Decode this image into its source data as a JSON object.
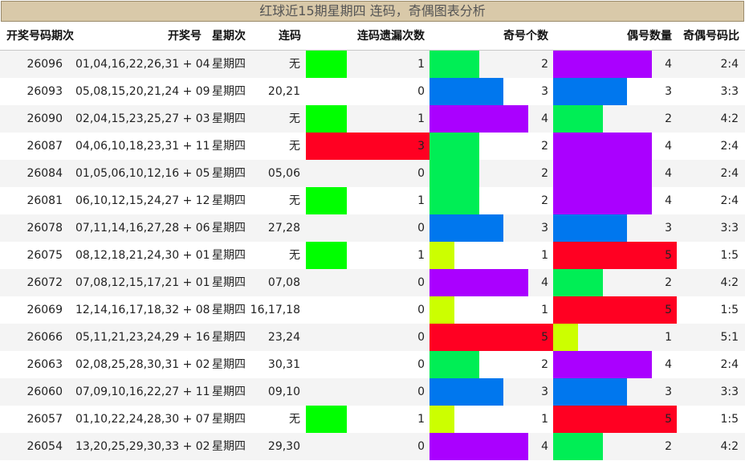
{
  "title": "红球近15期星期四 连码，奇偶图表分析",
  "headers": {
    "qi": "开奖号码期次",
    "numbers": "开奖号",
    "weekday": "星期次",
    "lianma": "连码",
    "miss": "连码遗漏次数",
    "odd": "奇号个数",
    "even": "偶号数量",
    "ratio": "奇偶号码比"
  },
  "colors": {
    "level_1": "#ccff00",
    "level_2": "#00ee55",
    "level_3": "#0077ee",
    "level_4": "#aa00ff",
    "level_5": "#ff0022",
    "miss_1": "#00ff00",
    "miss_3": "#ff0022",
    "row_alt": "#f4f4f4",
    "title_bg": "#d9c9a9"
  },
  "rows": [
    {
      "qi": "26096",
      "numbers": "01,04,16,22,26,31 + 04",
      "weekday": "星期四",
      "lianma": "无",
      "miss": 1,
      "odd": 2,
      "even": 4,
      "ratio": "2:4"
    },
    {
      "qi": "26093",
      "numbers": "05,08,15,20,21,24 + 09",
      "weekday": "星期四",
      "lianma": "20,21",
      "miss": 0,
      "odd": 3,
      "even": 3,
      "ratio": "3:3"
    },
    {
      "qi": "26090",
      "numbers": "02,04,15,23,25,27 + 03",
      "weekday": "星期四",
      "lianma": "无",
      "miss": 1,
      "odd": 4,
      "even": 2,
      "ratio": "4:2"
    },
    {
      "qi": "26087",
      "numbers": "04,06,10,18,23,31 + 11",
      "weekday": "星期四",
      "lianma": "无",
      "miss": 3,
      "odd": 2,
      "even": 4,
      "ratio": "2:4"
    },
    {
      "qi": "26084",
      "numbers": "01,05,06,10,12,16 + 05",
      "weekday": "星期四",
      "lianma": "05,06",
      "miss": 0,
      "odd": 2,
      "even": 4,
      "ratio": "2:4"
    },
    {
      "qi": "26081",
      "numbers": "06,10,12,15,24,27 + 12",
      "weekday": "星期四",
      "lianma": "无",
      "miss": 1,
      "odd": 2,
      "even": 4,
      "ratio": "2:4"
    },
    {
      "qi": "26078",
      "numbers": "07,11,14,16,27,28 + 06",
      "weekday": "星期四",
      "lianma": "27,28",
      "miss": 0,
      "odd": 3,
      "even": 3,
      "ratio": "3:3"
    },
    {
      "qi": "26075",
      "numbers": "08,12,18,21,24,30 + 01",
      "weekday": "星期四",
      "lianma": "无",
      "miss": 1,
      "odd": 1,
      "even": 5,
      "ratio": "1:5"
    },
    {
      "qi": "26072",
      "numbers": "07,08,12,15,17,21 + 01",
      "weekday": "星期四",
      "lianma": "07,08",
      "miss": 0,
      "odd": 4,
      "even": 2,
      "ratio": "4:2"
    },
    {
      "qi": "26069",
      "numbers": "12,14,16,17,18,32 + 08",
      "weekday": "星期四",
      "lianma": "16,17,18",
      "miss": 0,
      "odd": 1,
      "even": 5,
      "ratio": "1:5"
    },
    {
      "qi": "26066",
      "numbers": "05,11,21,23,24,29 + 16",
      "weekday": "星期四",
      "lianma": "23,24",
      "miss": 0,
      "odd": 5,
      "even": 1,
      "ratio": "5:1"
    },
    {
      "qi": "26063",
      "numbers": "02,08,25,28,30,31 + 02",
      "weekday": "星期四",
      "lianma": "30,31",
      "miss": 0,
      "odd": 2,
      "even": 4,
      "ratio": "2:4"
    },
    {
      "qi": "26060",
      "numbers": "07,09,10,16,22,27 + 11",
      "weekday": "星期四",
      "lianma": "09,10",
      "miss": 0,
      "odd": 3,
      "even": 3,
      "ratio": "3:3"
    },
    {
      "qi": "26057",
      "numbers": "01,10,22,24,28,30 + 07",
      "weekday": "星期四",
      "lianma": "无",
      "miss": 1,
      "odd": 1,
      "even": 5,
      "ratio": "1:5"
    },
    {
      "qi": "26054",
      "numbers": "13,20,25,29,30,33 + 02",
      "weekday": "星期四",
      "lianma": "29,30",
      "miss": 0,
      "odd": 4,
      "even": 2,
      "ratio": "4:2"
    }
  ]
}
